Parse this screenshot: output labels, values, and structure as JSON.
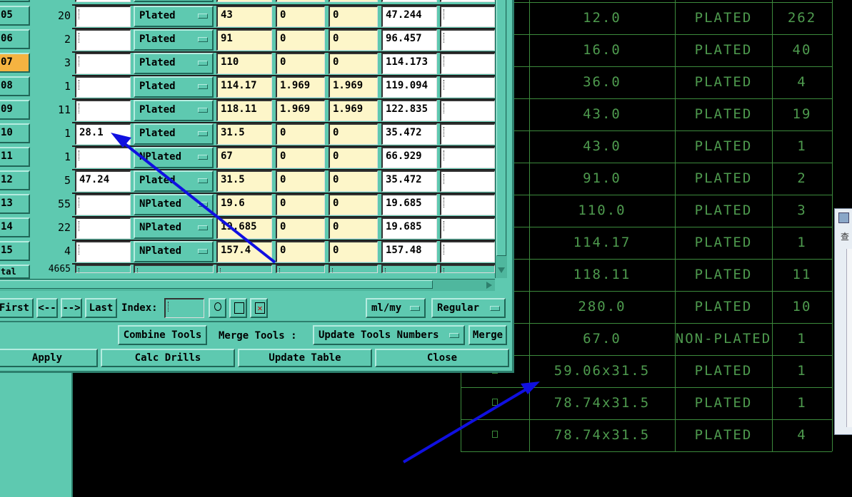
{
  "grid": {
    "rows": [
      {
        "idx": "05",
        "count": "20",
        "finish": "",
        "type": "Plated",
        "c1": "43",
        "c2": "0",
        "c3": "0",
        "c4": "47.244",
        "selected": false
      },
      {
        "idx": "06",
        "count": "2",
        "finish": "",
        "type": "Plated",
        "c1": "91",
        "c2": "0",
        "c3": "0",
        "c4": "96.457",
        "selected": false
      },
      {
        "idx": "07",
        "count": "3",
        "finish": "",
        "type": "Plated",
        "c1": "110",
        "c2": "0",
        "c3": "0",
        "c4": "114.173",
        "selected": true
      },
      {
        "idx": "08",
        "count": "1",
        "finish": "",
        "type": "Plated",
        "c1": "114.17",
        "c2": "1.969",
        "c3": "1.969",
        "c4": "119.094",
        "selected": false
      },
      {
        "idx": "09",
        "count": "11",
        "finish": "",
        "type": "Plated",
        "c1": "118.11",
        "c2": "1.969",
        "c3": "1.969",
        "c4": "122.835",
        "selected": false
      },
      {
        "idx": "10",
        "count": "1",
        "finish": "28.1",
        "type": "Plated",
        "c1": "31.5",
        "c2": "0",
        "c3": "0",
        "c4": "35.472",
        "selected": false
      },
      {
        "idx": "11",
        "count": "1",
        "finish": "",
        "type": "NPlated",
        "c1": "67",
        "c2": "0",
        "c3": "0",
        "c4": "66.929",
        "selected": false
      },
      {
        "idx": "12",
        "count": "5",
        "finish": "47.24",
        "type": "Plated",
        "c1": "31.5",
        "c2": "0",
        "c3": "0",
        "c4": "35.472",
        "selected": false
      },
      {
        "idx": "13",
        "count": "55",
        "finish": "",
        "type": "NPlated",
        "c1": "19.6",
        "c2": "0",
        "c3": "0",
        "c4": "19.685",
        "selected": false
      },
      {
        "idx": "14",
        "count": "22",
        "finish": "",
        "type": "NPlated",
        "c1": "19.685",
        "c2": "0",
        "c3": "0",
        "c4": "19.685",
        "selected": false
      },
      {
        "idx": "15",
        "count": "4",
        "finish": "",
        "type": "NPlated",
        "c1": "157.4",
        "c2": "0",
        "c3": "0",
        "c4": "157.48",
        "selected": false
      }
    ],
    "top_partial_type": "Plated",
    "total_label": "tal",
    "total_count": "4665"
  },
  "nav": {
    "first": "First",
    "prev": "<--",
    "next": "-->",
    "last": "Last",
    "index_label": "Index:",
    "index_value": "",
    "units": "ml/my",
    "mode": "Regular"
  },
  "tools": {
    "combine": "Combine Tools",
    "merge_label": "Merge Tools :",
    "merge_option": "Update Tools Numbers",
    "merge_button": "Merge"
  },
  "actions": {
    "apply": "Apply",
    "calc": "Calc Drills",
    "update": "Update Table",
    "close": "Close"
  },
  "cad_table": {
    "rows": [
      {
        "size": "12.0",
        "type": "PLATED",
        "qty": "262"
      },
      {
        "size": "16.0",
        "type": "PLATED",
        "qty": "40"
      },
      {
        "size": "36.0",
        "type": "PLATED",
        "qty": "4"
      },
      {
        "size": "43.0",
        "type": "PLATED",
        "qty": "19"
      },
      {
        "size": "43.0",
        "type": "PLATED",
        "qty": "1"
      },
      {
        "size": "91.0",
        "type": "PLATED",
        "qty": "2"
      },
      {
        "size": "110.0",
        "type": "PLATED",
        "qty": "3"
      },
      {
        "size": "114.17",
        "type": "PLATED",
        "qty": "1"
      },
      {
        "size": "118.11",
        "type": "PLATED",
        "qty": "11"
      },
      {
        "size": "280.0",
        "type": "PLATED",
        "qty": "10"
      },
      {
        "size": "67.0",
        "type": "NON-PLATED",
        "qty": "1"
      },
      {
        "size": "59.06x31.5",
        "type": "PLATED",
        "qty": "1"
      },
      {
        "size": "78.74x31.5",
        "type": "PLATED",
        "qty": "1"
      },
      {
        "size": "78.74x31.5",
        "type": "PLATED",
        "qty": "4"
      }
    ]
  },
  "side_panel_glyph": "查",
  "colors": {
    "dialog_bg": "#5ec9b0",
    "cell_yellow": "#fdf6c9",
    "selected": "#f5b341",
    "cad_green": "#4e9a4e",
    "arrow": "#1010e0"
  }
}
